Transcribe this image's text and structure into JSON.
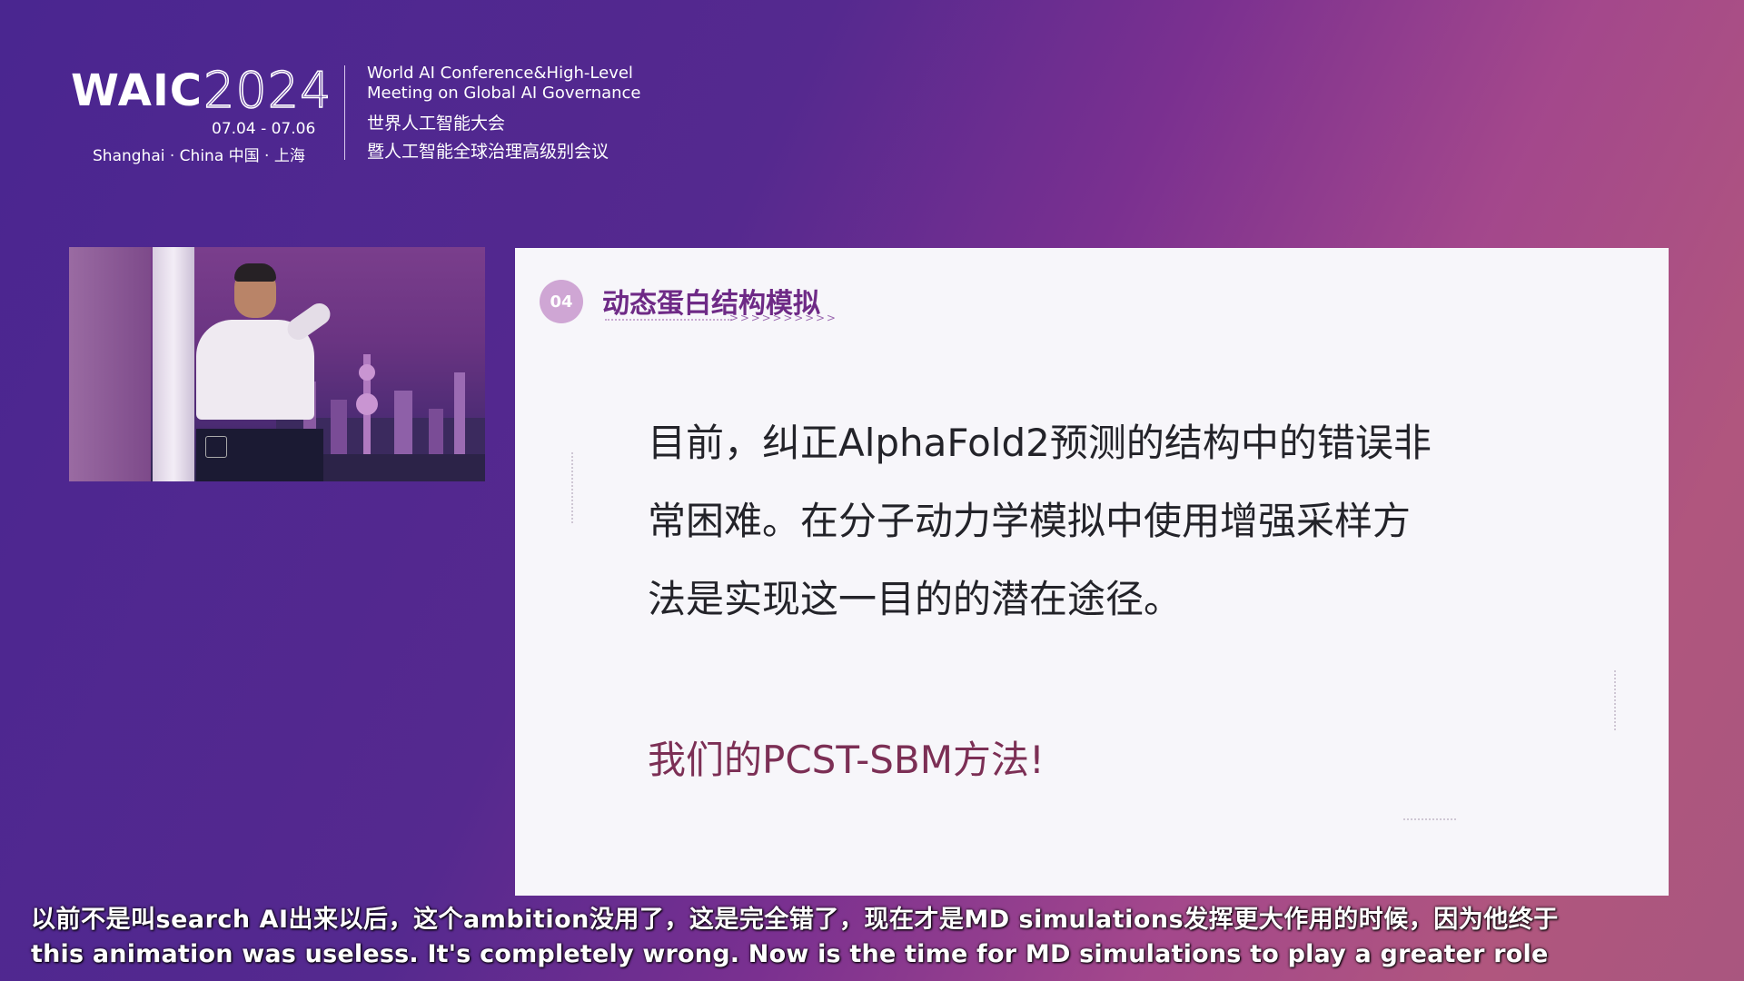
{
  "logo": {
    "waic": "WAIC",
    "year": "2024",
    "dates": "07.04 - 07.06",
    "city": "Shanghai · China  中国 · 上海"
  },
  "conference": {
    "en_line1": "World AI Conference&High-Level",
    "en_line2": "Meeting on Global AI Governance",
    "zh_line1": "世界人工智能大会",
    "zh_line2": "暨人工智能全球治理高级别会议"
  },
  "slide": {
    "badge": "04",
    "title": "动态蛋白结构模拟",
    "chevrons": "> > > > > > > > > >",
    "body_lines": [
      "目前，纠正AlphaFold2预测的结构中的错误非",
      "常困难。在分子动力学模拟中使用增强采样方",
      "法是实现这一目的的潜在途径。"
    ],
    "highlight": "我们的PCST-SBM方法!"
  },
  "subtitles": {
    "zh": "以前不是叫search AI出来以后，这个ambition没用了，这是完全错了，现在才是MD simulations发挥更大作用的时候，因为他终于",
    "en": "this animation was useless. It's completely wrong. Now is the time for MD simulations to play a greater role"
  },
  "colors": {
    "accent": "#6e2a86",
    "highlight": "#7c2f55",
    "badge": "#cfa6d4"
  }
}
